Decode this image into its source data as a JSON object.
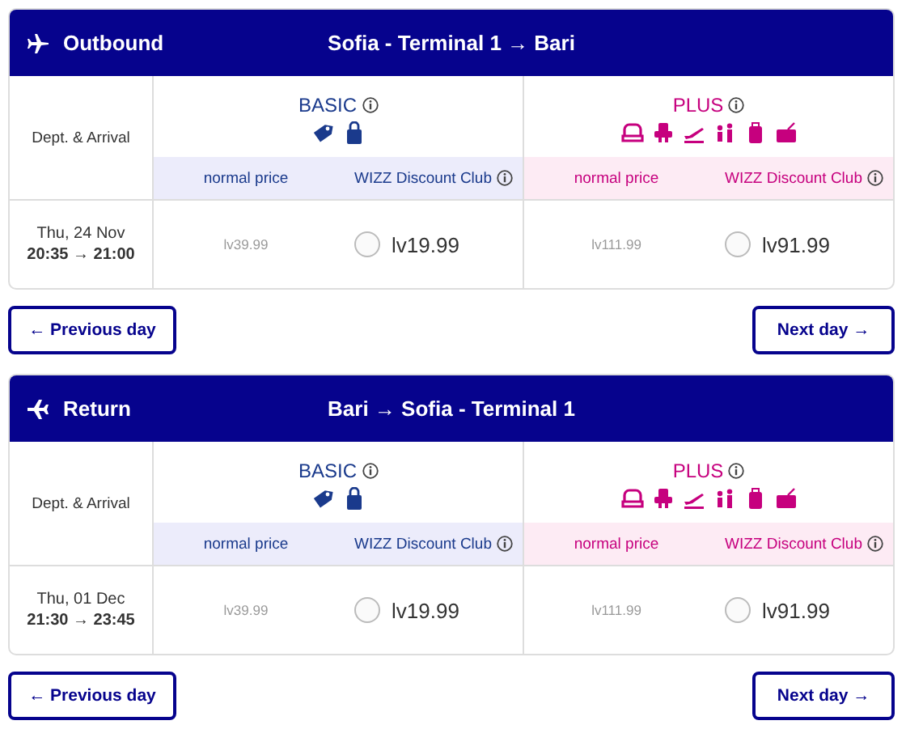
{
  "sections": [
    {
      "kind": "outbound",
      "title": "Outbound",
      "route": "Sofia - Terminal 1 → Bari",
      "times_label": "Dept. & Arrival",
      "fares": [
        {
          "kind": "basic",
          "name": "BASIC",
          "columns": [
            "normal price",
            "WIZZ Discount Club"
          ]
        },
        {
          "kind": "plus",
          "name": "PLUS",
          "columns": [
            "normal price",
            "WIZZ Discount Club"
          ]
        }
      ],
      "flight": {
        "date": "Thu, 24 Nov",
        "times": "20:35 → 21:00",
        "prices": [
          {
            "normal": "lv39.99",
            "club": "lv19.99",
            "selected": false
          },
          {
            "normal": "lv111.99",
            "club": "lv91.99",
            "selected": false
          }
        ]
      },
      "previous": "← Previous day",
      "next": "Next day →"
    },
    {
      "kind": "return",
      "title": "Return",
      "route": "Bari → Sofia - Terminal 1",
      "times_label": "Dept. & Arrival",
      "fares": [
        {
          "kind": "basic",
          "name": "BASIC",
          "columns": [
            "normal price",
            "WIZZ Discount Club"
          ]
        },
        {
          "kind": "plus",
          "name": "PLUS",
          "columns": [
            "normal price",
            "WIZZ Discount Club"
          ]
        }
      ],
      "flight": {
        "date": "Thu, 01 Dec",
        "times": "21:30 → 23:45",
        "prices": [
          {
            "normal": "lv39.99",
            "club": "lv19.99",
            "selected": false
          },
          {
            "normal": "lv111.99",
            "club": "lv91.99",
            "selected": false
          }
        ]
      },
      "previous": "← Previous day",
      "next": "Next day →"
    }
  ]
}
